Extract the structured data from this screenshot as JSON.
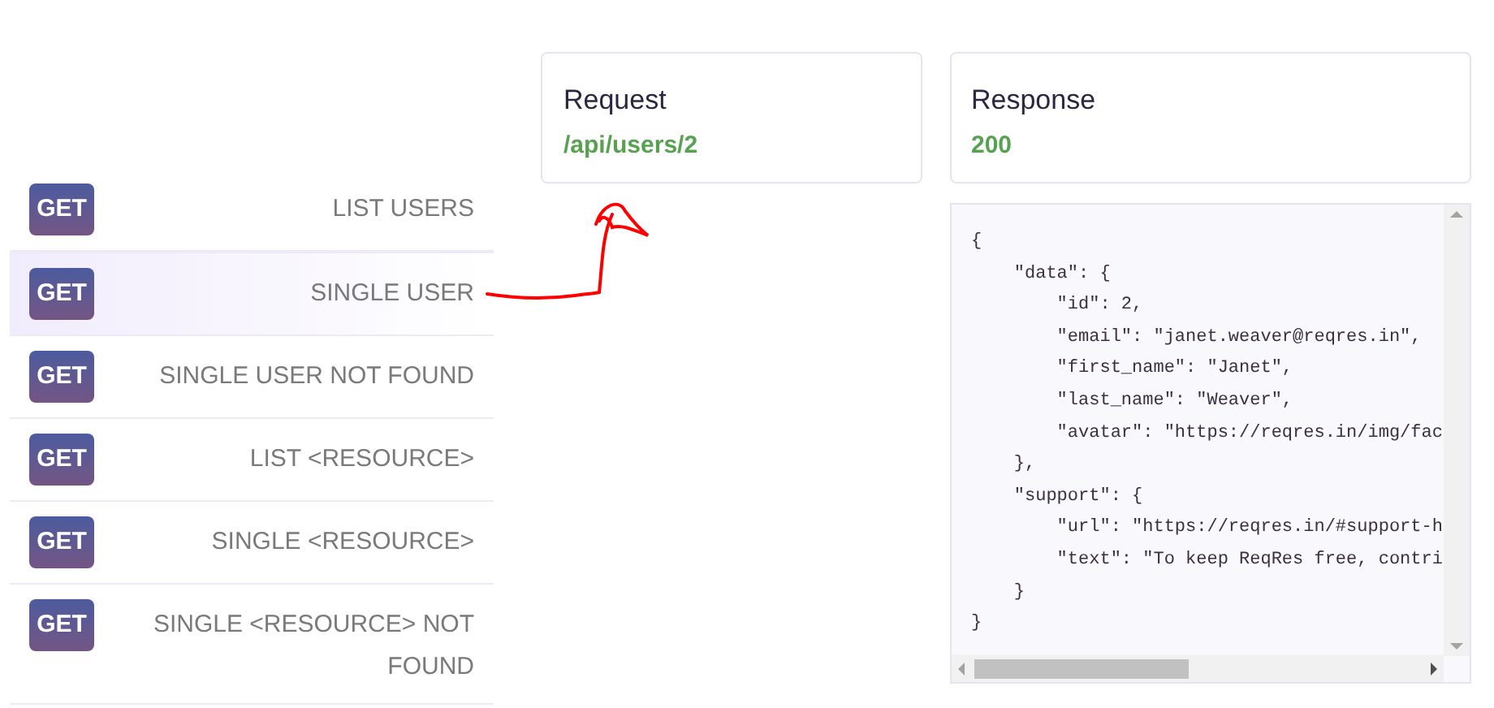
{
  "endpoints": [
    {
      "method": "GET",
      "label": "LIST USERS",
      "selected": false
    },
    {
      "method": "GET",
      "label": "SINGLE USER",
      "selected": true
    },
    {
      "method": "GET",
      "label": "SINGLE USER NOT FOUND",
      "selected": false
    },
    {
      "method": "GET",
      "label": "LIST <RESOURCE>",
      "selected": false
    },
    {
      "method": "GET",
      "label": "SINGLE <RESOURCE>",
      "selected": false
    },
    {
      "method": "GET",
      "label": "SINGLE <RESOURCE> NOT FOUND",
      "selected": false
    }
  ],
  "request": {
    "title": "Request",
    "value": "/api/users/2"
  },
  "response": {
    "title": "Response",
    "value": "200"
  },
  "response_body": [
    "{",
    "    \"data\": {",
    "        \"id\": 2,",
    "        \"email\": \"janet.weaver@reqres.in\",",
    "        \"first_name\": \"Janet\",",
    "        \"last_name\": \"Weaver\",",
    "        \"avatar\": \"https://reqres.in/img/fac",
    "    },",
    "    \"support\": {",
    "        \"url\": \"https://reqres.in/#support-h",
    "        \"text\": \"To keep ReqRes free, contri",
    "    }",
    "}"
  ]
}
